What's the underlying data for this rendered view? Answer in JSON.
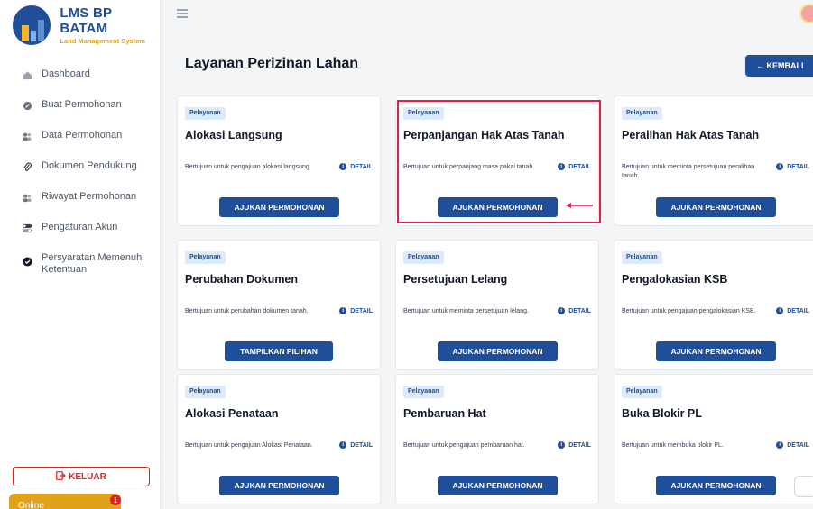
{
  "brand": {
    "title": "LMS BP BATAM",
    "subtitle": "Land Management System"
  },
  "nav": [
    {
      "label": "Dashboard",
      "icon": "home-icon"
    },
    {
      "label": "Buat Permohonan",
      "icon": "file-edit-icon"
    },
    {
      "label": "Data Permohonan",
      "icon": "users-icon"
    },
    {
      "label": "Dokumen Pendukung",
      "icon": "paperclip-icon"
    },
    {
      "label": "Riwayat Permohonan",
      "icon": "users-icon"
    },
    {
      "label": "Pengaturan Akun",
      "icon": "toggle-icon"
    },
    {
      "label": "Persyaratan Memenuhi Ketentuan",
      "icon": "check-circle-icon"
    }
  ],
  "logout_label": "KELUAR",
  "online_label": "Online",
  "online_badge": "1",
  "page_title": "Layanan Perizinan Lahan",
  "back_label": "← KEMBALI",
  "detail_label": "DETAIL",
  "cards": [
    {
      "tag": "Pelayanan",
      "title": "Alokasi Langsung",
      "desc": "Bertujuan untuk pengajuan alokasi langsung.",
      "button": "AJUKAN PERMOHONAN"
    },
    {
      "tag": "Pelayanan",
      "title": "Perpanjangan Hak Atas Tanah",
      "desc": "Bertujuan untuk perpanjang masa pakai tanah.",
      "button": "AJUKAN PERMOHONAN"
    },
    {
      "tag": "Pelayanan",
      "title": "Peralihan Hak Atas Tanah",
      "desc": "Bertujuan untuk meminta persetujuan peralihan tanah.",
      "button": "AJUKAN PERMOHONAN"
    },
    {
      "tag": "Pelayanan",
      "title": "Perubahan Dokumen",
      "desc": "Bertujuan untuk perubahan dokumen tanah.",
      "button": "TAMPILKAN PILIHAN"
    },
    {
      "tag": "Pelayanan",
      "title": "Persetujuan Lelang",
      "desc": "Bertujuan untuk meminta persetujuan lelang.",
      "button": "AJUKAN PERMOHONAN"
    },
    {
      "tag": "Pelayanan",
      "title": "Pengalokasian KSB",
      "desc": "Bertujuan untuk pengajuan pengalokasian KSB.",
      "button": "AJUKAN PERMOHONAN"
    },
    {
      "tag": "Pelayanan",
      "title": "Alokasi Penataan",
      "desc": "Bertujuan untuk pengajuan Alokasi Penataan.",
      "button": "AJUKAN PERMOHONAN"
    },
    {
      "tag": "Pelayanan",
      "title": "Pembaruan Hat",
      "desc": "Bertujuan untuk pengajuan pembaruan hat.",
      "button": "AJUKAN PERMOHONAN"
    },
    {
      "tag": "Pelayanan",
      "title": "Buka Blokir PL",
      "desc": "Bertujuan untuk membuka blokir PL.",
      "button": "AJUKAN PERMOHONAN"
    }
  ],
  "colors": {
    "primary": "#1f4e9a",
    "accent": "#e0a21b",
    "danger": "#dc2626",
    "highlight": "#e11d48"
  }
}
